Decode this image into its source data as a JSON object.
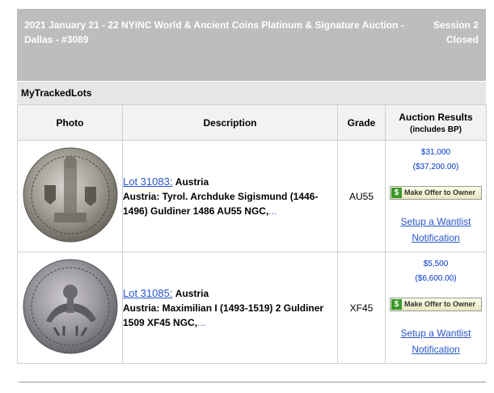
{
  "header": {
    "title": "2021 January 21 - 22 NYINC World & Ancient Coins Platinum & Signature Auction - Dallas - #3089",
    "session": "Session 2",
    "status": "Closed"
  },
  "section_title": "MyTrackedLots",
  "columns": {
    "photo": "Photo",
    "description": "Description",
    "grade": "Grade",
    "results": "Auction Results",
    "results_sub": "(includes BP)"
  },
  "lots": [
    {
      "lot_link": "Lot 31083:",
      "country": "Austria",
      "description": "Austria: Tyrol. Archduke Sigismund (1446-1496) Guldiner 1486 AU55 NGC,",
      "ellipsis": "...",
      "grade": "AU55",
      "price": "$31,000",
      "price_bp": "($37,200.00)",
      "offer_label": "Make Offer to Owner",
      "wantlist": "Setup a Wantlist Notification"
    },
    {
      "lot_link": "Lot 31085:",
      "country": "Austria",
      "description": "Austria: Maximilian I (1493-1519) 2 Guldiner 1509 XF45 NGC,",
      "ellipsis": "...",
      "grade": "XF45",
      "price": "$5,500",
      "price_bp": "($6,600.00)",
      "offer_label": "Make Offer to Owner",
      "wantlist": "Setup a Wantlist Notification"
    }
  ]
}
